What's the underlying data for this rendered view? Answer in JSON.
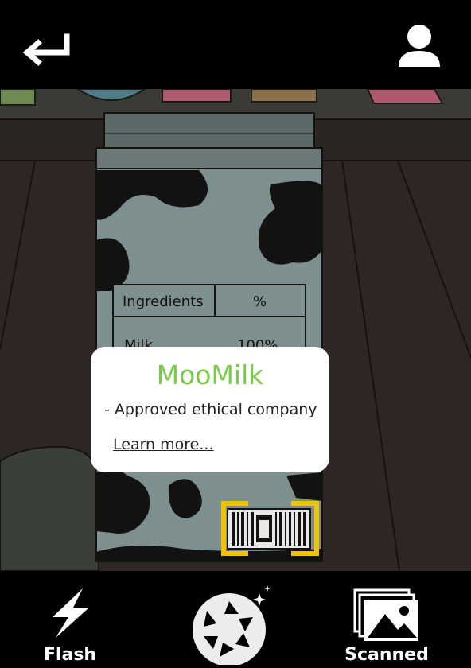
{
  "header": {
    "back_icon": "return-arrow-icon",
    "profile_icon": "user-icon"
  },
  "scene": {
    "carton_table_header": [
      "Ingredients",
      "%"
    ],
    "carton_table_row": [
      "Milk",
      "100%"
    ],
    "barcode_icon": "barcode-icon",
    "scan_frame_color": "#f2c200"
  },
  "popup": {
    "title": "MooMilk",
    "description": "- Approved ethical company",
    "link": "Learn more..."
  },
  "footer": {
    "flash_label": "Flash",
    "flash_icon": "lightning-icon",
    "shutter_icon": "camera-shutter-icon",
    "scanned_label": "Scanned",
    "scanned_icon": "image-gallery-icon"
  },
  "colors": {
    "accent_green": "#7ac94a",
    "bar_background": "#000000"
  }
}
